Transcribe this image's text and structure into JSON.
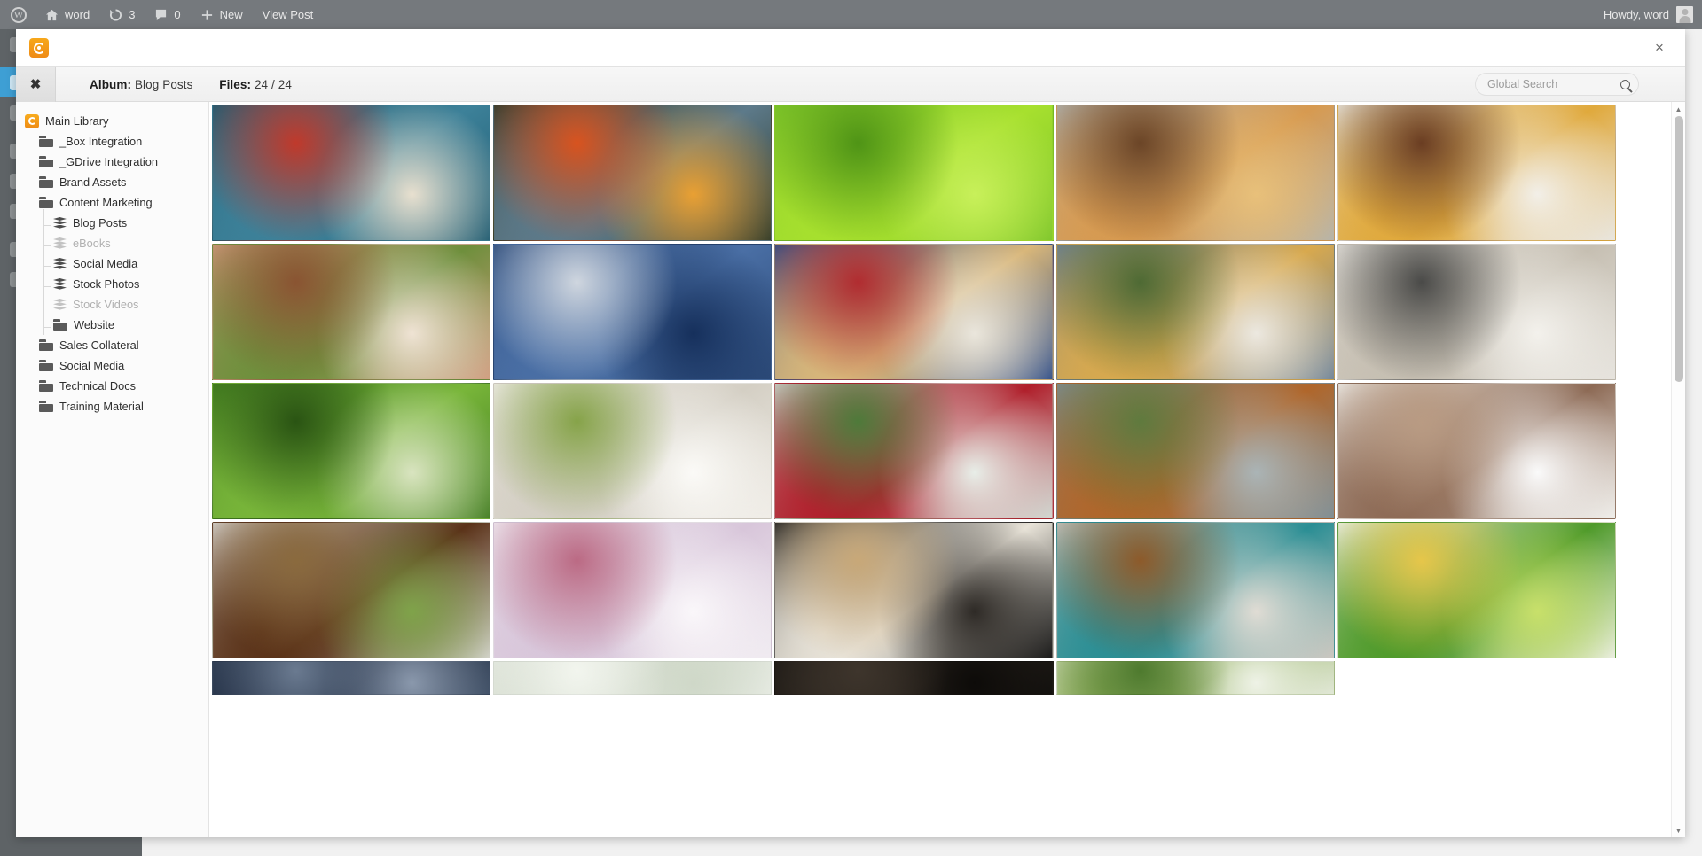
{
  "adminbar": {
    "logo_icon": "wordpress-logo-icon",
    "items": [
      {
        "icon": "home-icon",
        "label": "word"
      },
      {
        "icon": "refresh-icon",
        "label": "3"
      },
      {
        "icon": "comment-icon",
        "label": "0"
      },
      {
        "icon": "plus-icon",
        "label": "New"
      },
      {
        "icon": "",
        "label": "View Post"
      }
    ],
    "greeting": "Howdy, word",
    "avatar_icon": "user-avatar-icon"
  },
  "modal": {
    "brand_icon": "canto-logo-icon",
    "close_icon": "close-icon",
    "close_label": "×",
    "toolbar": {
      "close_icon": "close-panel-icon",
      "close_label": "✖",
      "album_key": "Album:",
      "album_value": "Blog Posts",
      "files_key": "Files:",
      "files_value": "24 / 24"
    },
    "search": {
      "placeholder": "Global Search",
      "value": "",
      "icon": "search-icon"
    },
    "scrollbar": {
      "up_icon": "caret-up-icon",
      "up_glyph": "▲",
      "down_icon": "caret-down-icon",
      "down_glyph": "▼"
    }
  },
  "tree": {
    "items": [
      {
        "label": "Main Library",
        "icon": "library-icon",
        "depth": 0,
        "type": "library",
        "disabled": false
      },
      {
        "label": "_Box Integration",
        "icon": "folder-icon",
        "depth": 1,
        "type": "folder",
        "disabled": false
      },
      {
        "label": "_GDrive Integration",
        "icon": "folder-icon",
        "depth": 1,
        "type": "folder",
        "disabled": false
      },
      {
        "label": "Brand Assets",
        "icon": "folder-icon",
        "depth": 1,
        "type": "folder",
        "disabled": false
      },
      {
        "label": "Content Marketing",
        "icon": "folder-icon",
        "depth": 1,
        "type": "folder",
        "disabled": false
      },
      {
        "label": "Blog Posts",
        "icon": "album-icon",
        "depth": 2,
        "type": "album",
        "disabled": false
      },
      {
        "label": "eBooks",
        "icon": "album-icon",
        "depth": 2,
        "type": "album",
        "disabled": true
      },
      {
        "label": "Social Media",
        "icon": "album-icon",
        "depth": 2,
        "type": "album",
        "disabled": false
      },
      {
        "label": "Stock Photos",
        "icon": "album-icon",
        "depth": 2,
        "type": "album",
        "disabled": false
      },
      {
        "label": "Stock Videos",
        "icon": "album-icon",
        "depth": 2,
        "type": "album",
        "disabled": true
      },
      {
        "label": "Website",
        "icon": "folder-icon",
        "depth": 2,
        "type": "folder",
        "disabled": false
      },
      {
        "label": "Sales Collateral",
        "icon": "folder-icon",
        "depth": 1,
        "type": "folder",
        "disabled": false
      },
      {
        "label": "Social Media",
        "icon": "folder-icon",
        "depth": 1,
        "type": "folder",
        "disabled": false
      },
      {
        "label": "Technical Docs",
        "icon": "folder-icon",
        "depth": 1,
        "type": "folder",
        "disabled": false
      },
      {
        "label": "Training Material",
        "icon": "folder-icon",
        "depth": 1,
        "type": "folder",
        "disabled": false
      }
    ]
  },
  "grid": {
    "thumbnails": [
      {
        "name": "charcuterie-board-on-teal",
        "colors": [
          "#1d5a70",
          "#3d8199",
          "#c0392b",
          "#e8e0cf"
        ]
      },
      {
        "name": "fruit-market-stall",
        "colors": [
          "#2e3a2a",
          "#5d7a8a",
          "#d8531f",
          "#e9a033"
        ]
      },
      {
        "name": "green-limes",
        "colors": [
          "#7cc42a",
          "#a7e02e",
          "#4f9416",
          "#c8f05a"
        ]
      },
      {
        "name": "three-cheeseburgers",
        "colors": [
          "#b2b3ae",
          "#d79a50",
          "#6b4527",
          "#e8c07a"
        ]
      },
      {
        "name": "plated-burger-with-slaw",
        "colors": [
          "#e8e5de",
          "#e0a93c",
          "#6a3d22",
          "#f2efe8"
        ]
      },
      {
        "name": "avocado-burger",
        "colors": [
          "#cf9a7c",
          "#6e8f3c",
          "#8a5432",
          "#efe3d4"
        ]
      },
      {
        "name": "blueberry-cartons",
        "colors": [
          "#2c4a78",
          "#4a6fa5",
          "#cfd6df",
          "#16305c"
        ]
      },
      {
        "name": "waffle-with-berries",
        "colors": [
          "#2b4a86",
          "#d9b77a",
          "#b12c30",
          "#eae6dc"
        ]
      },
      {
        "name": "burger-and-fries-plate",
        "colors": [
          "#6c8196",
          "#d8a94e",
          "#4e6a34",
          "#ece8e0"
        ]
      },
      {
        "name": "table-with-bowls",
        "colors": [
          "#e5e2dc",
          "#c6bfb2",
          "#4a4a48",
          "#f3f1ec"
        ]
      },
      {
        "name": "green-beans-closeup",
        "colors": [
          "#3f7a1e",
          "#79b63a",
          "#2a5413",
          "#d9e4c0"
        ]
      },
      {
        "name": "milk-jug-and-fruit-bowl",
        "colors": [
          "#efece6",
          "#d4cfc4",
          "#86a349",
          "#fbfaf7"
        ]
      },
      {
        "name": "cherries-on-branch",
        "colors": [
          "#cfd6d0",
          "#b01f2b",
          "#4e7a3a",
          "#e8eee8"
        ]
      },
      {
        "name": "carrots-in-crate",
        "colors": [
          "#7d8c92",
          "#b0662a",
          "#5f7a3e",
          "#aab4b6"
        ]
      },
      {
        "name": "quinoa-in-white-dish",
        "colors": [
          "#efeeea",
          "#8d6a55",
          "#b99b83",
          "#fafafa"
        ]
      },
      {
        "name": "creme-brulee-dessert",
        "colors": [
          "#d8d6d2",
          "#5a3218",
          "#8a6a3e",
          "#7fa34a"
        ]
      },
      {
        "name": "pastel-dessert-table",
        "colors": [
          "#efeaf0",
          "#d8c6da",
          "#bb6a84",
          "#faf7fa"
        ]
      },
      {
        "name": "cappuccino-cup-dark",
        "colors": [
          "#1a1a1a",
          "#e8e3d8",
          "#c8a878",
          "#2e2a26"
        ]
      },
      {
        "name": "nuts-and-dates-bowls",
        "colors": [
          "#c9c5be",
          "#2a8e94",
          "#8d5a2a",
          "#e0dcd4"
        ]
      },
      {
        "name": "plated-dish-with-chives",
        "colors": [
          "#eef0ea",
          "#4f9a2a",
          "#e6c64a",
          "#c8e06a"
        ]
      },
      {
        "name": "blueberries-macro",
        "colors": [
          "#3a4a60",
          "#1f2b40",
          "#6a7a90",
          "#8a98ac"
        ]
      },
      {
        "name": "pale-dessert-crop",
        "colors": [
          "#e8ece4",
          "#d6ddd0",
          "#f2f5ee",
          "#cfd8c8"
        ]
      },
      {
        "name": "dark-coffee-crop",
        "colors": [
          "#14120f",
          "#2a241e",
          "#3e352c",
          "#0d0b09"
        ]
      },
      {
        "name": "salad-greens-crop",
        "colors": [
          "#dfe6d4",
          "#8fae5a",
          "#4e7a2e",
          "#eef2e6"
        ]
      }
    ]
  },
  "wpmenu": {
    "items": [
      {
        "label": "",
        "active": false
      },
      {
        "label": "",
        "active": true
      },
      {
        "label": "",
        "active": false
      },
      {
        "label": "",
        "active": false
      },
      {
        "label": "",
        "active": false
      },
      {
        "label": "",
        "active": false
      },
      {
        "label": "",
        "active": false
      },
      {
        "label": "",
        "active": false
      }
    ]
  }
}
